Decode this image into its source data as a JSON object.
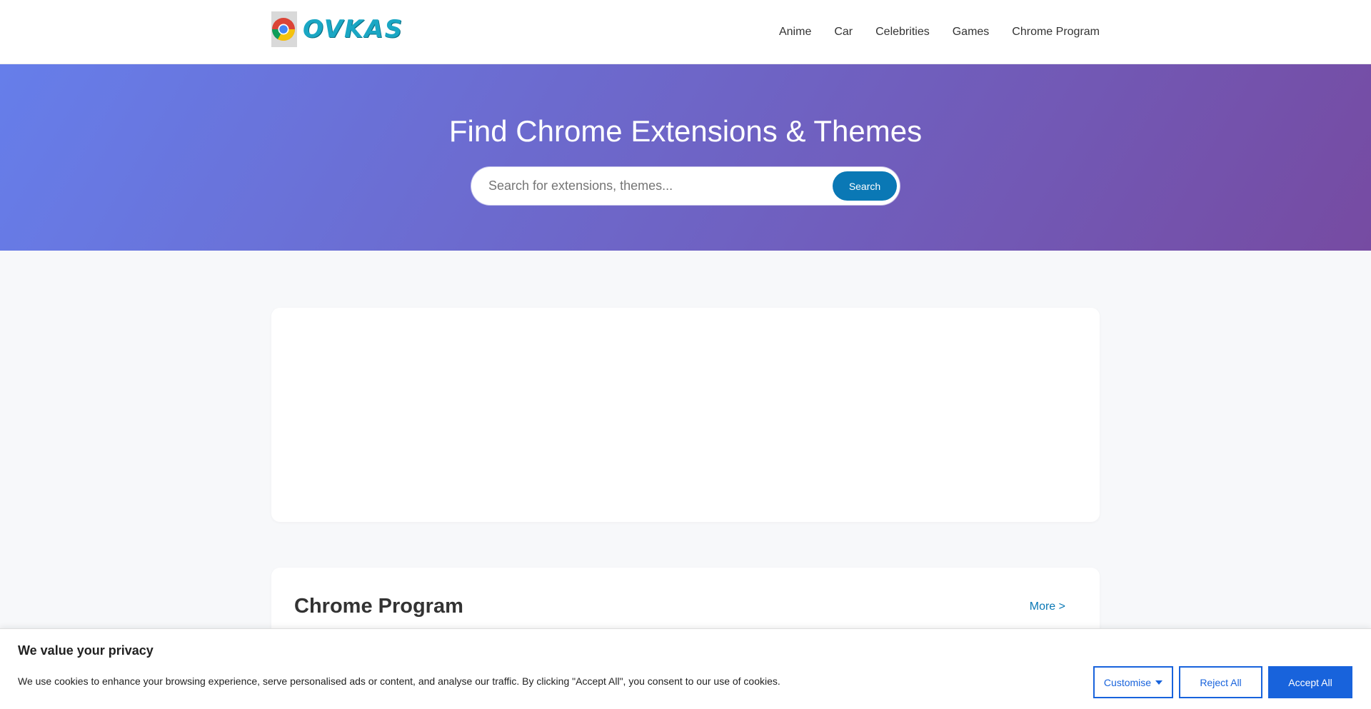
{
  "header": {
    "logo_text": "OVKAS",
    "nav": [
      {
        "label": "Anime"
      },
      {
        "label": "Car"
      },
      {
        "label": "Celebrities"
      },
      {
        "label": "Games"
      },
      {
        "label": "Chrome Program"
      }
    ]
  },
  "hero": {
    "title": "Find Chrome Extensions & Themes",
    "search_placeholder": "Search for extensions, themes...",
    "search_button": "Search"
  },
  "section": {
    "title": "Chrome Program",
    "more_link": "More >"
  },
  "cookie_banner": {
    "title": "We value your privacy",
    "text": "We use cookies to enhance your browsing experience, serve personalised ads or content, and analyse our traffic. By clicking \"Accept All\", you consent to our use of cookies.",
    "customise": "Customise",
    "reject": "Reject All",
    "accept": "Accept All"
  },
  "colors": {
    "hero_gradient_start": "#667eea",
    "hero_gradient_end": "#764ba2",
    "accent_blue": "#0a78b5",
    "cookie_blue": "#1863dc"
  },
  "icons": {
    "logo": "chrome-logo-icon",
    "customise_caret": "caret-down-icon"
  }
}
